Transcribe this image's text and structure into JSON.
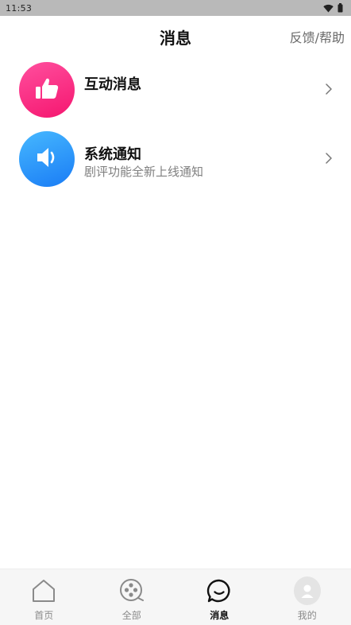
{
  "status_bar": {
    "time": "11:53"
  },
  "header": {
    "title": "消息",
    "feedback": "反馈/帮助"
  },
  "messages": [
    {
      "title": "互动消息",
      "subtitle": "",
      "icon": "thumbs-up-icon",
      "color": "#f5166f"
    },
    {
      "title": "系统通知",
      "subtitle": "剧评功能全新上线通知",
      "icon": "speaker-icon",
      "color": "#1a7cf5"
    }
  ],
  "tabs": [
    {
      "label": "首页",
      "icon": "home-icon",
      "active": false
    },
    {
      "label": "全部",
      "icon": "film-reel-icon",
      "active": false
    },
    {
      "label": "消息",
      "icon": "chat-bubble-icon",
      "active": true
    },
    {
      "label": "我的",
      "icon": "profile-avatar-icon",
      "active": false
    }
  ]
}
